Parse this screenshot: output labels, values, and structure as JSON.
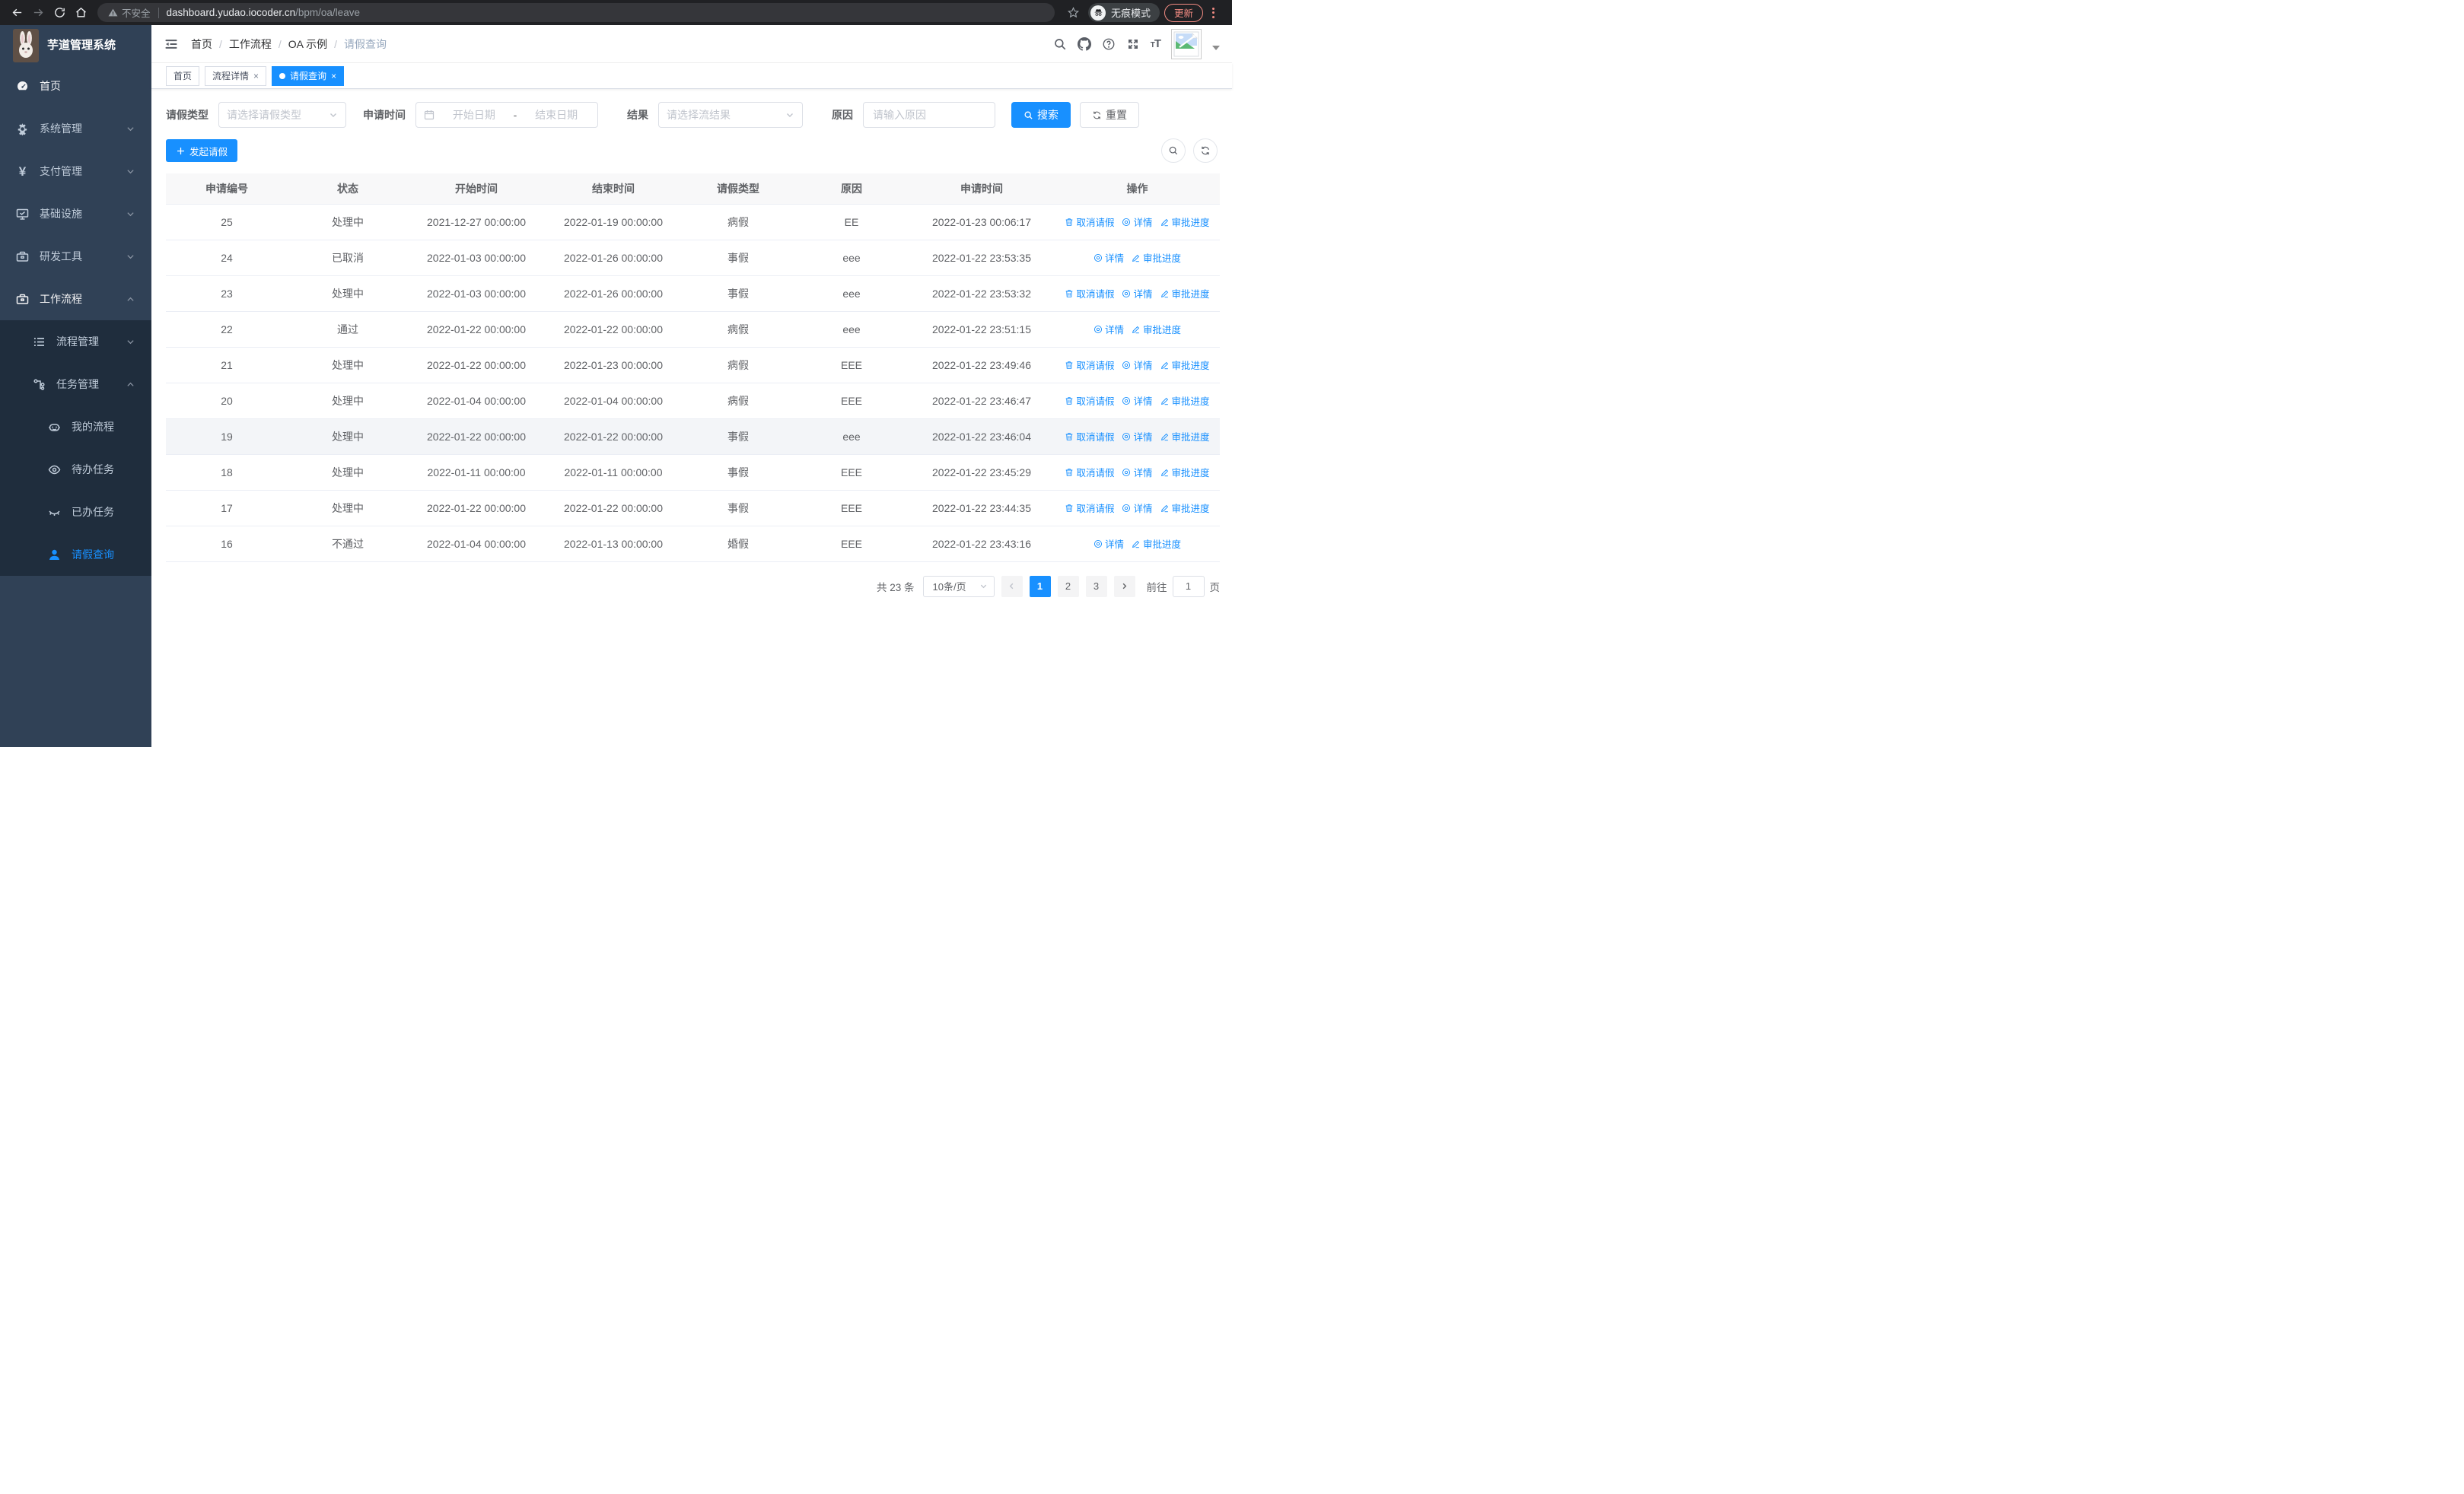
{
  "colors": {
    "accent": "#1890ff",
    "sidebar_bg": "#304156",
    "submenu_bg": "#1f2d3d",
    "danger": "#f28b82"
  },
  "browser": {
    "not_secure_label": "不安全",
    "url_domain": "dashboard.yudao.iocoder.cn",
    "url_path": "/bpm/oa/leave",
    "incognito_label": "无痕模式",
    "update_label": "更新"
  },
  "app": {
    "title": "芋道管理系统"
  },
  "breadcrumb": {
    "items": [
      "首页",
      "工作流程",
      "OA 示例",
      "请假查询"
    ],
    "separator": "/"
  },
  "tabs": {
    "items": [
      {
        "label": "首页",
        "closable": false,
        "active": false
      },
      {
        "label": "流程详情",
        "closable": true,
        "active": false
      },
      {
        "label": "请假查询",
        "closable": true,
        "active": true
      }
    ],
    "close_glyph": "×"
  },
  "sidebar": {
    "items": [
      {
        "label": "首页",
        "icon": "dashboard-icon",
        "level": 0,
        "white": true
      },
      {
        "label": "系统管理",
        "icon": "gear-icon",
        "level": 0,
        "chevron": "down"
      },
      {
        "label": "支付管理",
        "icon": "yen-icon",
        "level": 0,
        "chevron": "down"
      },
      {
        "label": "基础设施",
        "icon": "monitor-icon",
        "level": 0,
        "chevron": "down"
      },
      {
        "label": "研发工具",
        "icon": "toolbox-icon",
        "level": 0,
        "chevron": "down"
      },
      {
        "label": "工作流程",
        "icon": "briefcase-icon",
        "level": 0,
        "chevron": "up",
        "white": true
      },
      {
        "label": "流程管理",
        "icon": "list-icon",
        "level": 1,
        "chevron": "down",
        "submenu": true
      },
      {
        "label": "任务管理",
        "icon": "flow-icon",
        "level": 1,
        "chevron": "up",
        "submenu": true
      },
      {
        "label": "我的流程",
        "icon": "robot-icon",
        "level": 2,
        "submenu": true
      },
      {
        "label": "待办任务",
        "icon": "eye-icon",
        "level": 2,
        "submenu": true
      },
      {
        "label": "已办任务",
        "icon": "eye-closed-icon",
        "level": 2,
        "submenu": true
      },
      {
        "label": "请假查询",
        "icon": "user-icon",
        "level": 2,
        "submenu": true,
        "active": true
      }
    ]
  },
  "filters": {
    "leave_type": {
      "label": "请假类型",
      "placeholder": "请选择请假类型"
    },
    "apply_time": {
      "label": "申请时间",
      "start_placeholder": "开始日期",
      "separator": "-",
      "end_placeholder": "结束日期"
    },
    "result": {
      "label": "结果",
      "placeholder": "请选择流结果"
    },
    "reason": {
      "label": "原因",
      "placeholder": "请输入原因"
    },
    "search_label": "搜索",
    "reset_label": "重置"
  },
  "toolbar": {
    "create_label": "发起请假"
  },
  "table": {
    "columns": [
      "申请编号",
      "状态",
      "开始时间",
      "结束时间",
      "请假类型",
      "原因",
      "申请时间",
      "操作"
    ],
    "action_defs": {
      "cancel": {
        "label": "取消请假",
        "icon": "trash-icon"
      },
      "detail": {
        "label": "详情",
        "icon": "view-icon"
      },
      "progress": {
        "label": "审批进度",
        "icon": "edit-icon"
      }
    },
    "rows": [
      {
        "id": "25",
        "status": "处理中",
        "start": "2021-12-27 00:00:00",
        "end": "2022-01-19 00:00:00",
        "type": "病假",
        "reason": "EE",
        "apply_time": "2022-01-23 00:06:17",
        "actions": [
          "cancel",
          "detail",
          "progress"
        ]
      },
      {
        "id": "24",
        "status": "已取消",
        "start": "2022-01-03 00:00:00",
        "end": "2022-01-26 00:00:00",
        "type": "事假",
        "reason": "eee",
        "apply_time": "2022-01-22 23:53:35",
        "actions": [
          "detail",
          "progress"
        ]
      },
      {
        "id": "23",
        "status": "处理中",
        "start": "2022-01-03 00:00:00",
        "end": "2022-01-26 00:00:00",
        "type": "事假",
        "reason": "eee",
        "apply_time": "2022-01-22 23:53:32",
        "actions": [
          "cancel",
          "detail",
          "progress"
        ]
      },
      {
        "id": "22",
        "status": "通过",
        "start": "2022-01-22 00:00:00",
        "end": "2022-01-22 00:00:00",
        "type": "病假",
        "reason": "eee",
        "apply_time": "2022-01-22 23:51:15",
        "actions": [
          "detail",
          "progress"
        ]
      },
      {
        "id": "21",
        "status": "处理中",
        "start": "2022-01-22 00:00:00",
        "end": "2022-01-23 00:00:00",
        "type": "病假",
        "reason": "EEE",
        "apply_time": "2022-01-22 23:49:46",
        "actions": [
          "cancel",
          "detail",
          "progress"
        ]
      },
      {
        "id": "20",
        "status": "处理中",
        "start": "2022-01-04 00:00:00",
        "end": "2022-01-04 00:00:00",
        "type": "病假",
        "reason": "EEE",
        "apply_time": "2022-01-22 23:46:47",
        "actions": [
          "cancel",
          "detail",
          "progress"
        ]
      },
      {
        "id": "19",
        "status": "处理中",
        "start": "2022-01-22 00:00:00",
        "end": "2022-01-22 00:00:00",
        "type": "事假",
        "reason": "eee",
        "apply_time": "2022-01-22 23:46:04",
        "actions": [
          "cancel",
          "detail",
          "progress"
        ],
        "highlighted": true
      },
      {
        "id": "18",
        "status": "处理中",
        "start": "2022-01-11 00:00:00",
        "end": "2022-01-11 00:00:00",
        "type": "事假",
        "reason": "EEE",
        "apply_time": "2022-01-22 23:45:29",
        "actions": [
          "cancel",
          "detail",
          "progress"
        ]
      },
      {
        "id": "17",
        "status": "处理中",
        "start": "2022-01-22 00:00:00",
        "end": "2022-01-22 00:00:00",
        "type": "事假",
        "reason": "EEE",
        "apply_time": "2022-01-22 23:44:35",
        "actions": [
          "cancel",
          "detail",
          "progress"
        ]
      },
      {
        "id": "16",
        "status": "不通过",
        "start": "2022-01-04 00:00:00",
        "end": "2022-01-13 00:00:00",
        "type": "婚假",
        "reason": "EEE",
        "apply_time": "2022-01-22 23:43:16",
        "actions": [
          "detail",
          "progress"
        ]
      }
    ]
  },
  "pagination": {
    "total_label": "共 23 条",
    "page_size_label": "10条/页",
    "pages": [
      "1",
      "2",
      "3"
    ],
    "active_page": "1",
    "prev_disabled": true,
    "goto_label": "前往",
    "goto_value": "1",
    "page_suffix": "页"
  }
}
